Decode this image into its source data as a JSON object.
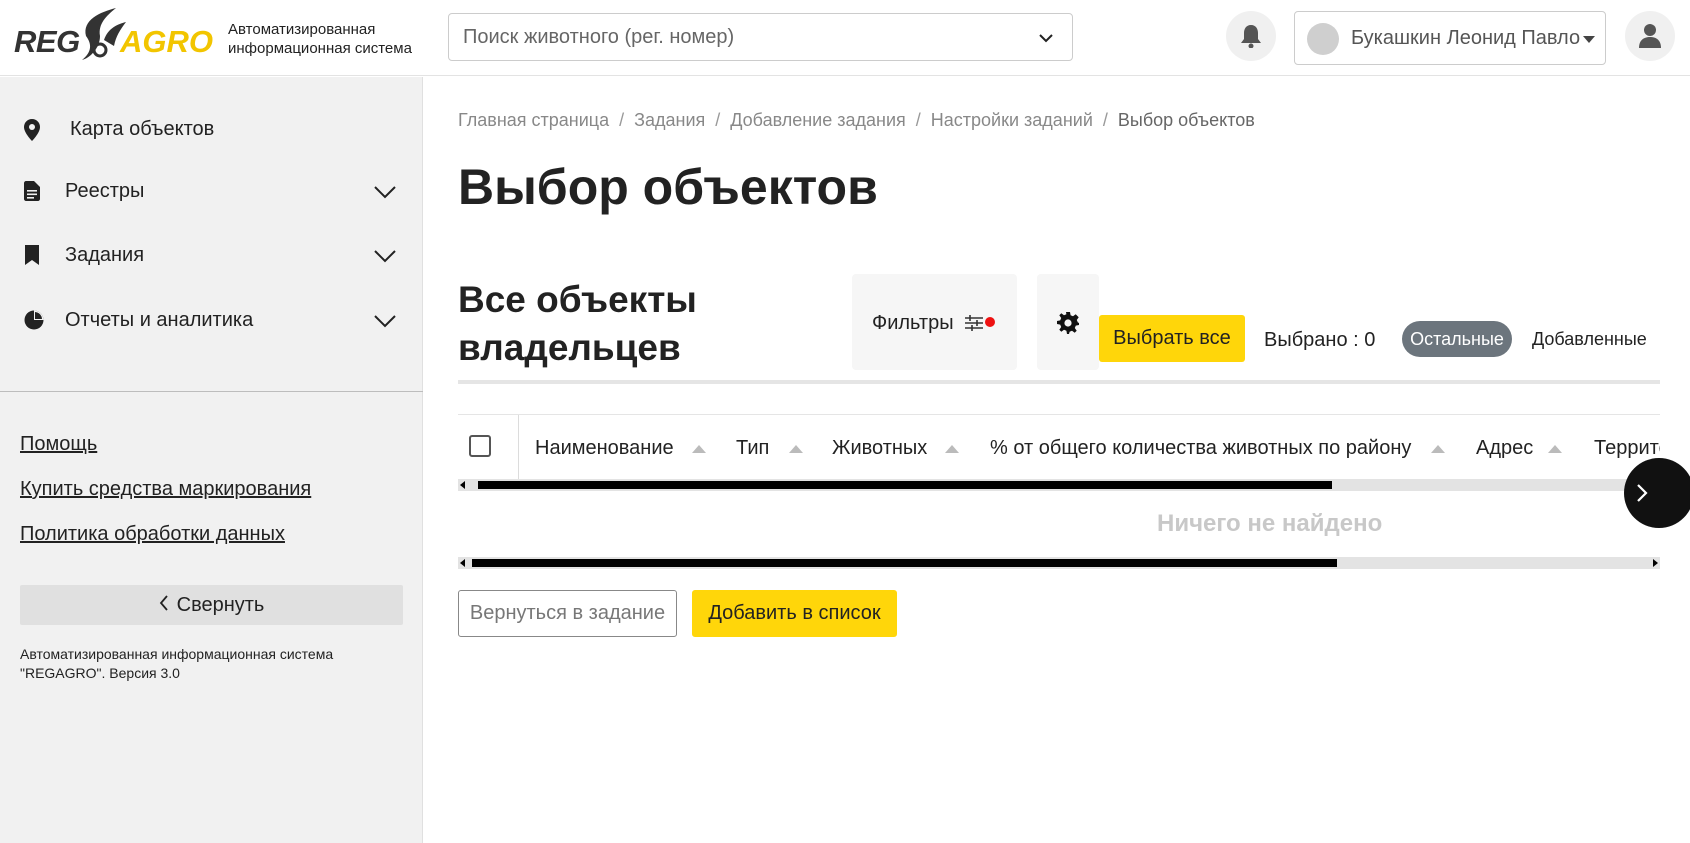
{
  "header": {
    "logo_left": "REG",
    "logo_right": "AGRO",
    "system_name_line1": "Автоматизированная",
    "system_name_line2": "информационная система",
    "search_placeholder": "Поиск животного (рег. номер)",
    "user_name": "Букашкин Леонид Павло"
  },
  "sidebar": {
    "items": [
      {
        "label": "Карта объектов",
        "icon": "map-pin-icon"
      },
      {
        "label": "Реестры",
        "icon": "document-icon"
      },
      {
        "label": "Задания",
        "icon": "bookmark-icon"
      },
      {
        "label": "Отчеты и аналитика",
        "icon": "pie-chart-icon"
      }
    ],
    "links": [
      "Помощь",
      "Купить средства маркирования",
      "Политика обработки данных"
    ],
    "collapse_label": "Свернуть",
    "version_line1": "Автоматизированная информационная система",
    "version_line2": "\"REGAGRO\". Версия 3.0"
  },
  "breadcrumb": [
    "Главная страница",
    "Задания",
    "Добавление задания",
    "Настройки заданий",
    "Выбор объектов"
  ],
  "page_title": "Выбор объектов",
  "section": {
    "title_line1": "Все объекты",
    "title_line2": "владельцев",
    "filters_label": "Фильтры",
    "select_all_label": "Выбрать все",
    "selected_label": "Выбрано : 0",
    "tab_other": "Остальные",
    "tab_added": "Добавленные"
  },
  "table": {
    "columns": [
      "Наименование",
      "Тип",
      "Животных",
      "% от общего количества животных по району",
      "Адрес",
      "Террито"
    ],
    "empty_text": "Ничего не найдено"
  },
  "actions": {
    "back_label": "Вернуться в задание",
    "add_label": "Добавить в список"
  },
  "colors": {
    "accent": "#ffd60a",
    "pill_active": "#6c757d",
    "filter_dot": "#ee1111"
  }
}
